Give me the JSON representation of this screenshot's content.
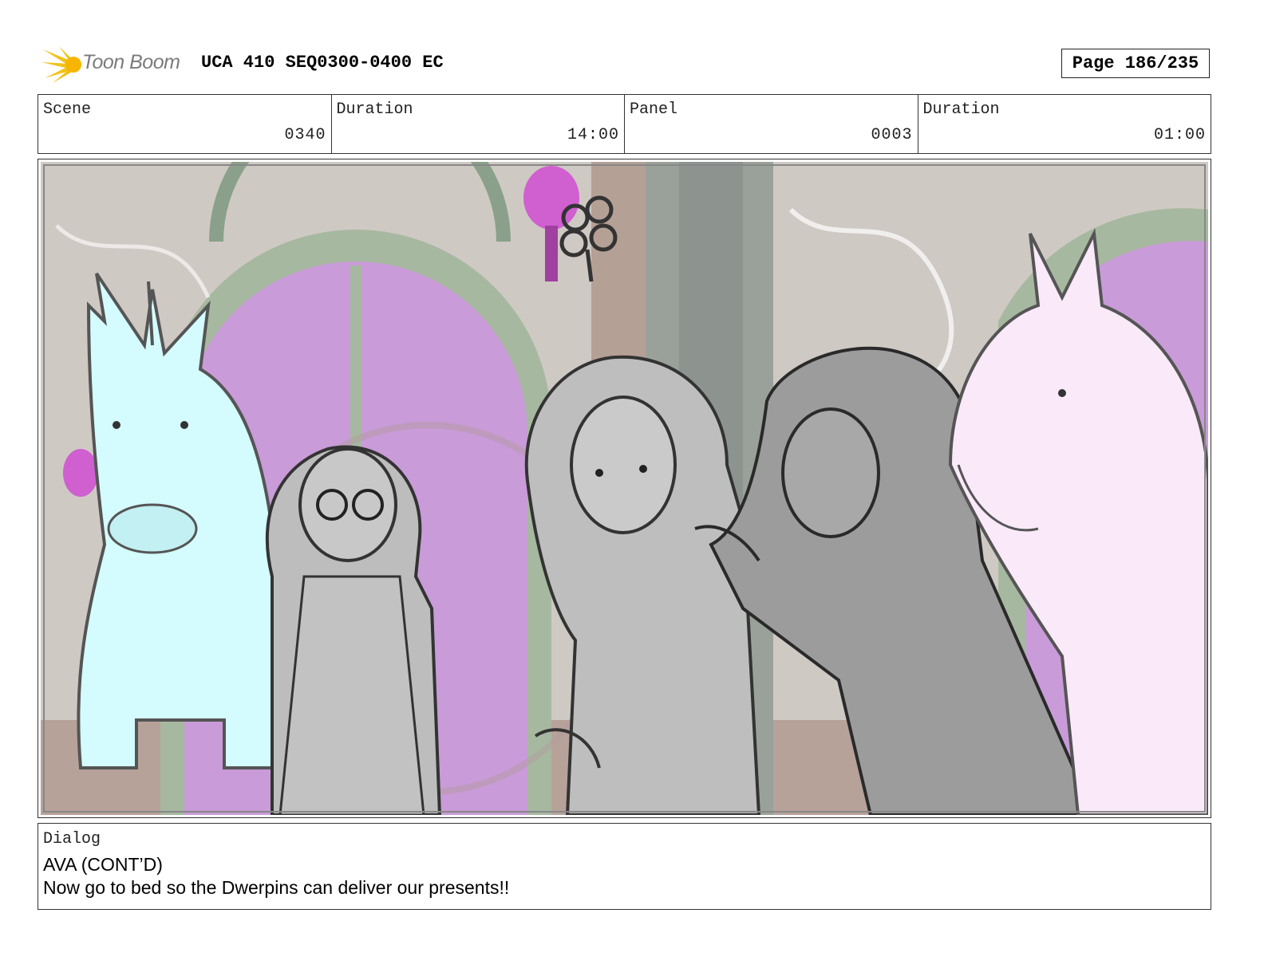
{
  "header": {
    "logo_text": "Toon Boom",
    "project_title": "UCA 410 SEQ0300-0400 EC",
    "page_label": "Page 186/235"
  },
  "info": {
    "scene_label": "Scene",
    "scene_value": "0340",
    "scene_duration_label": "Duration",
    "scene_duration_value": "14:00",
    "panel_label": "Panel",
    "panel_value": "0003",
    "panel_duration_label": "Duration",
    "panel_duration_value": "01:00"
  },
  "dialog": {
    "label": "Dialog",
    "speaker": "AVA (CONT’D)",
    "line": "Now go to bed so the Dwerpins can deliver our presents!!"
  },
  "colors": {
    "logo_yellow": "#f2c21b",
    "arch_purple": "#c99bd8",
    "arch_green": "#a7b8a0",
    "unicorn_left": "#d4fbfd",
    "unicorn_right": "#f9e9f9",
    "lamp_magenta": "#d05fd0",
    "character_gray": "#b9b9b9"
  }
}
